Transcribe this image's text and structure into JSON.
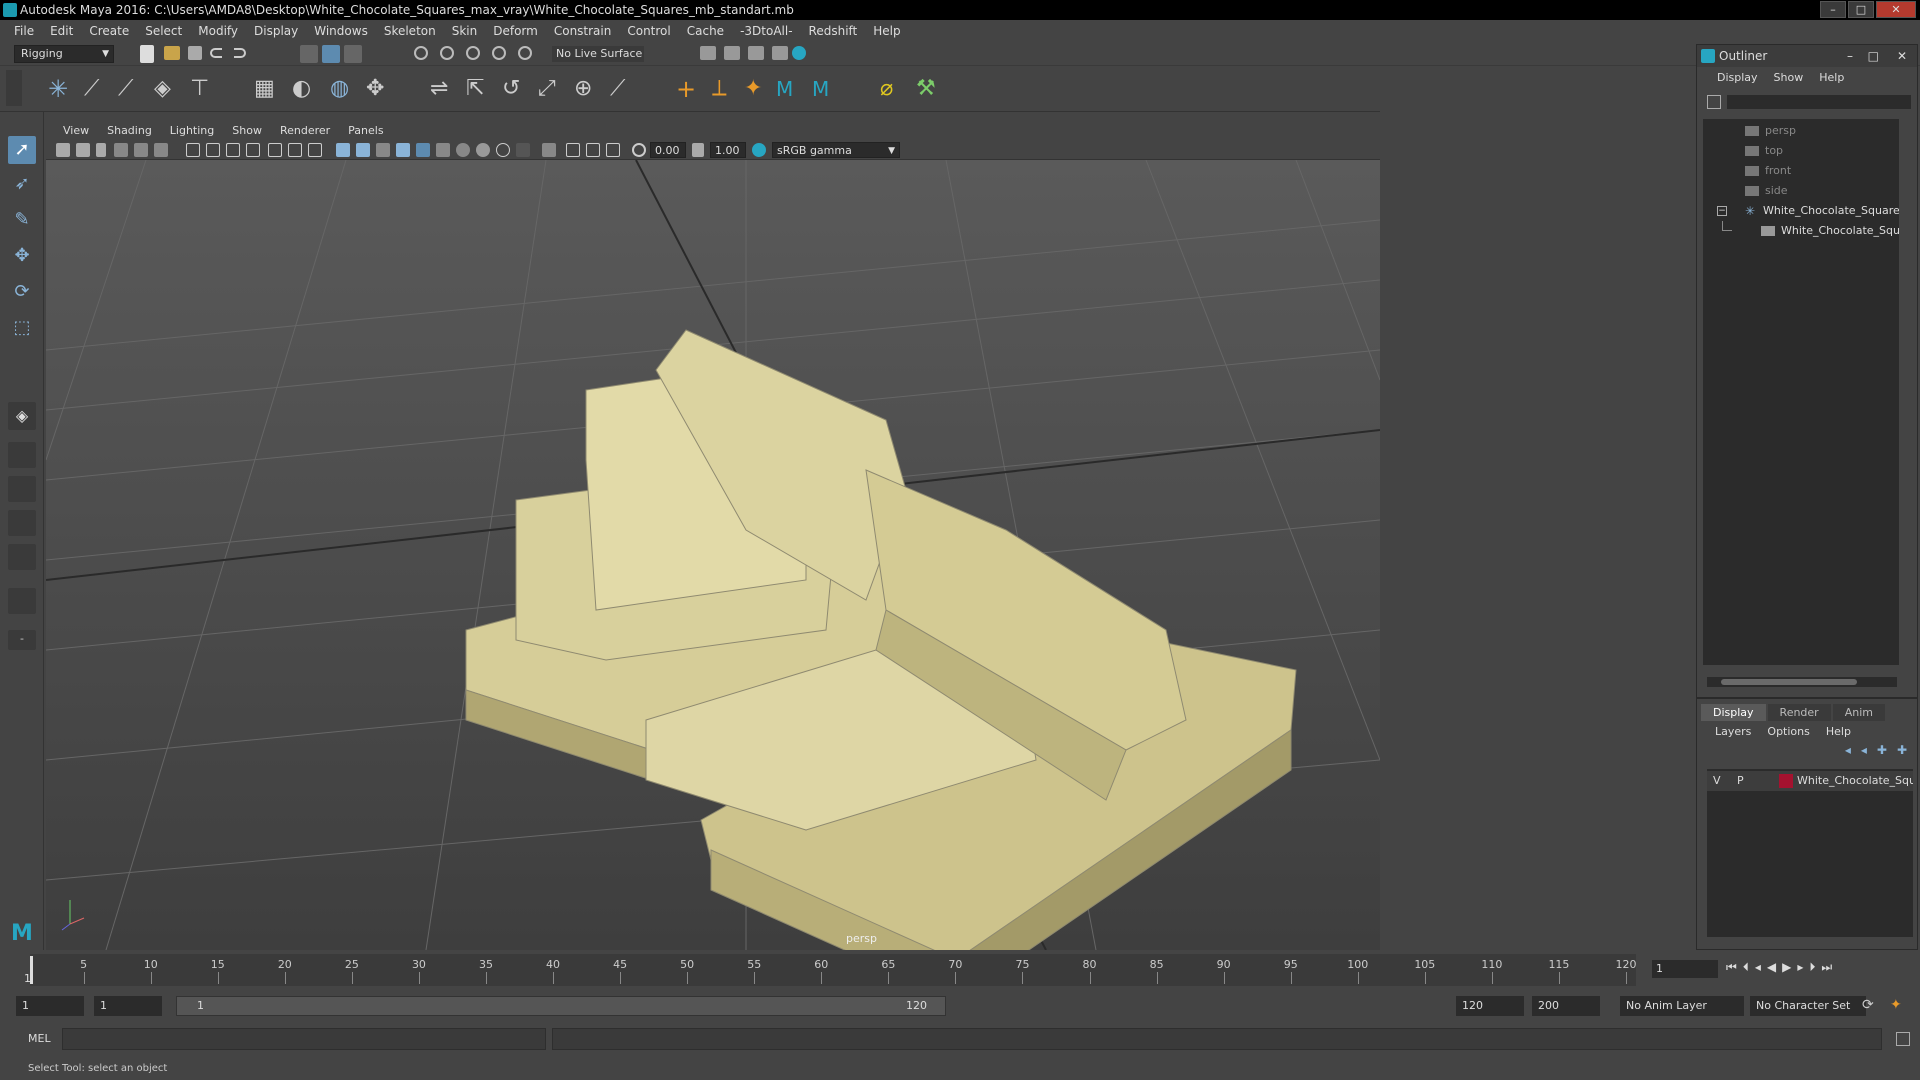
{
  "title": "Autodesk Maya 2016: C:\\Users\\AMDA8\\Desktop\\White_Chocolate_Squares_max_vray\\White_Chocolate_Squares_mb_standart.mb",
  "menus": [
    "File",
    "Edit",
    "Create",
    "Select",
    "Modify",
    "Display",
    "Windows",
    "Skeleton",
    "Skin",
    "Deform",
    "Constrain",
    "Control",
    "Cache",
    "-3DtoAll-",
    "Redshift",
    "Help"
  ],
  "status_line": {
    "mode": "Rigging",
    "live_surface": "No Live Surface"
  },
  "panel_menu": [
    "View",
    "Shading",
    "Lighting",
    "Show",
    "Renderer",
    "Panels"
  ],
  "panel_tools": {
    "exposure": "0.00",
    "gamma": "1.00",
    "color_space": "sRGB gamma"
  },
  "viewport": {
    "camera": "persp"
  },
  "outliner": {
    "title": "Outliner",
    "menu": [
      "Display",
      "Show",
      "Help"
    ],
    "items": [
      {
        "label": "persp",
        "type": "camera"
      },
      {
        "label": "top",
        "type": "camera"
      },
      {
        "label": "front",
        "type": "camera"
      },
      {
        "label": "side",
        "type": "camera"
      },
      {
        "label": "White_Chocolate_Squares",
        "type": "group"
      },
      {
        "label": "White_Chocolate_Squ",
        "type": "mesh"
      }
    ]
  },
  "layer_editor": {
    "tabs": [
      "Display",
      "Render",
      "Anim"
    ],
    "active_tab": "Display",
    "menu": [
      "Layers",
      "Options",
      "Help"
    ],
    "layers": [
      {
        "visible": "V",
        "playback": "P",
        "name": "White_Chocolate_Squ",
        "color": "#a4122f"
      }
    ]
  },
  "time_slider": {
    "ticks": [
      "5",
      "10",
      "15",
      "20",
      "25",
      "30",
      "35",
      "40",
      "45",
      "50",
      "55",
      "60",
      "65",
      "70",
      "75",
      "80",
      "85",
      "90",
      "95",
      "100",
      "105",
      "110",
      "115",
      "120"
    ],
    "start_label": "1",
    "current_frame": "1"
  },
  "range_slider": {
    "start": "1",
    "playback_start": "1",
    "range_start_label": "1",
    "range_end_label": "120",
    "playback_end": "120",
    "end": "200",
    "anim_layer": "No Anim Layer",
    "character_set": "No Character Set"
  },
  "command_line": {
    "language": "MEL"
  },
  "help_line": "Select Tool: select an object",
  "colors": {
    "accent": "#27a6c2",
    "layer_color": "#a4122f",
    "chocolate": "#d8cf9a"
  }
}
